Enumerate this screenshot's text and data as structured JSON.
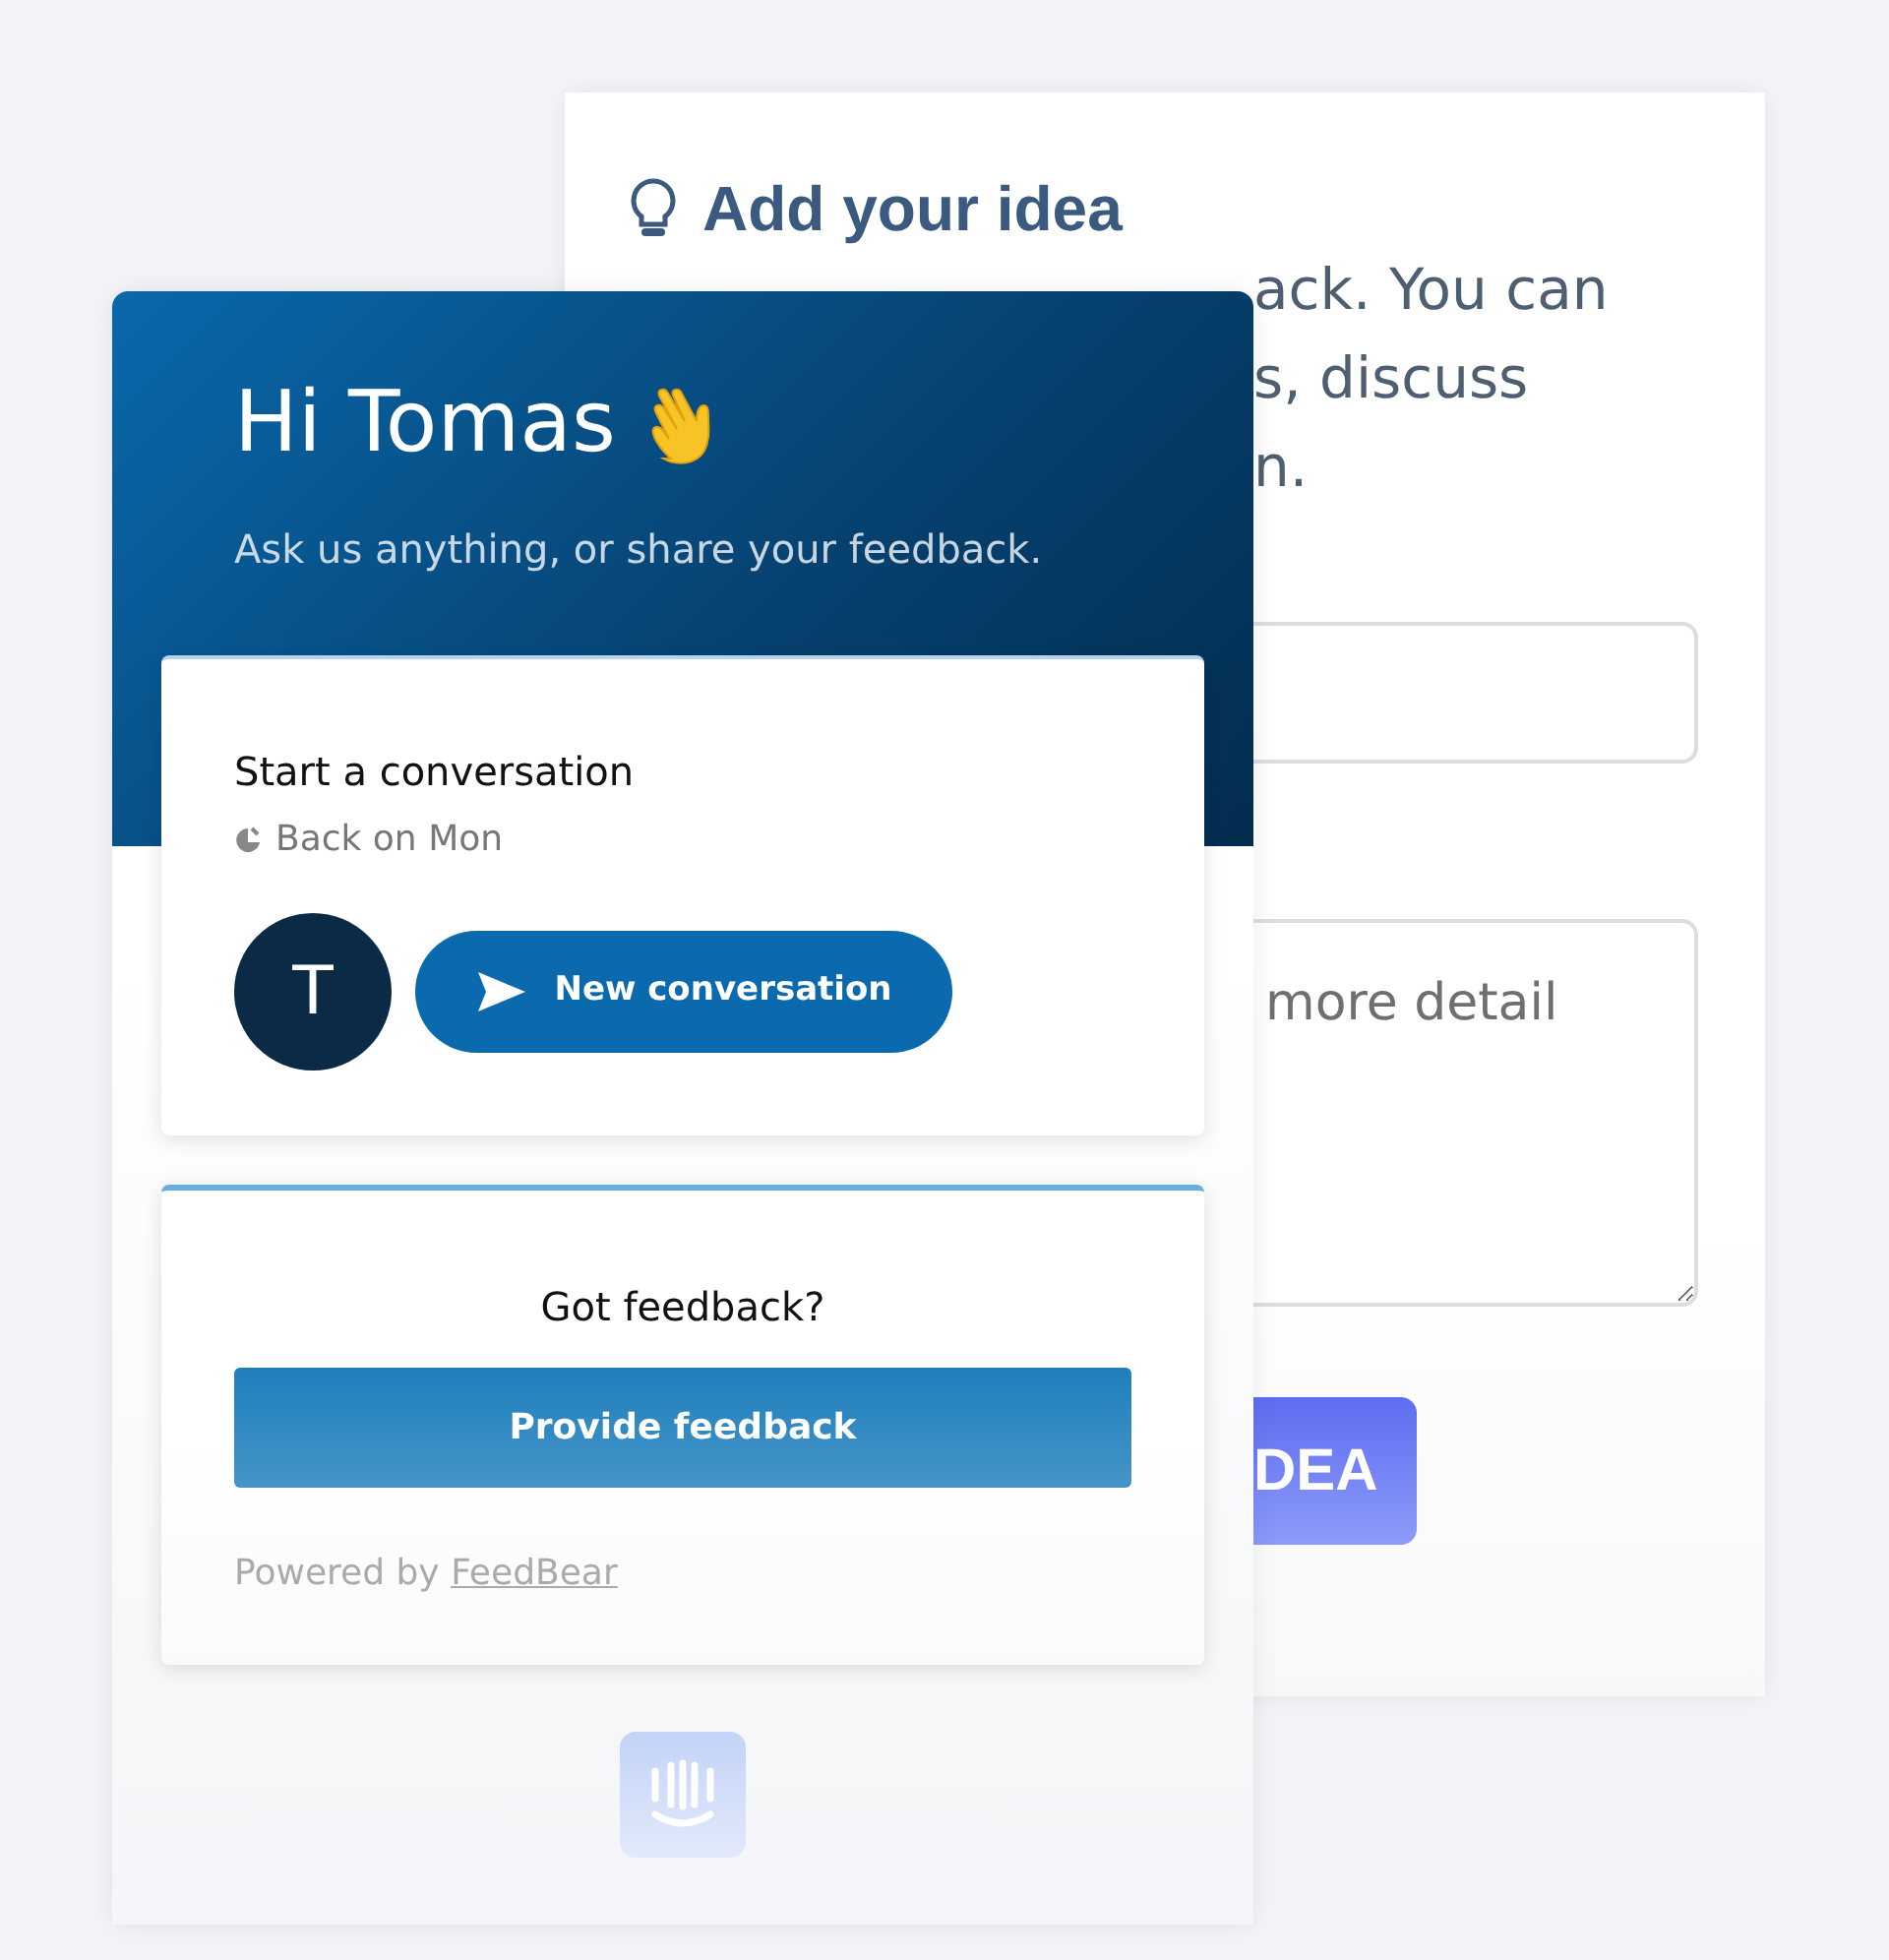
{
  "idea_form": {
    "title": "Add your idea",
    "description_lines": [
      "ack. You can",
      "s, discuss",
      "n."
    ],
    "details_field": {
      "placeholder": "more detail"
    },
    "submit_button": "DEA"
  },
  "messenger": {
    "greeting": "Hi Tomas",
    "subtitle": "Ask us anything, or share your feedback.",
    "conversation_card": {
      "title": "Start a conversation",
      "availability": "Back on Mon",
      "avatar_initial": "T",
      "button": "New conversation"
    },
    "feedback_card": {
      "title": "Got feedback?",
      "button": "Provide feedback",
      "powered_by": "Powered by",
      "link": "FeedBear"
    }
  }
}
